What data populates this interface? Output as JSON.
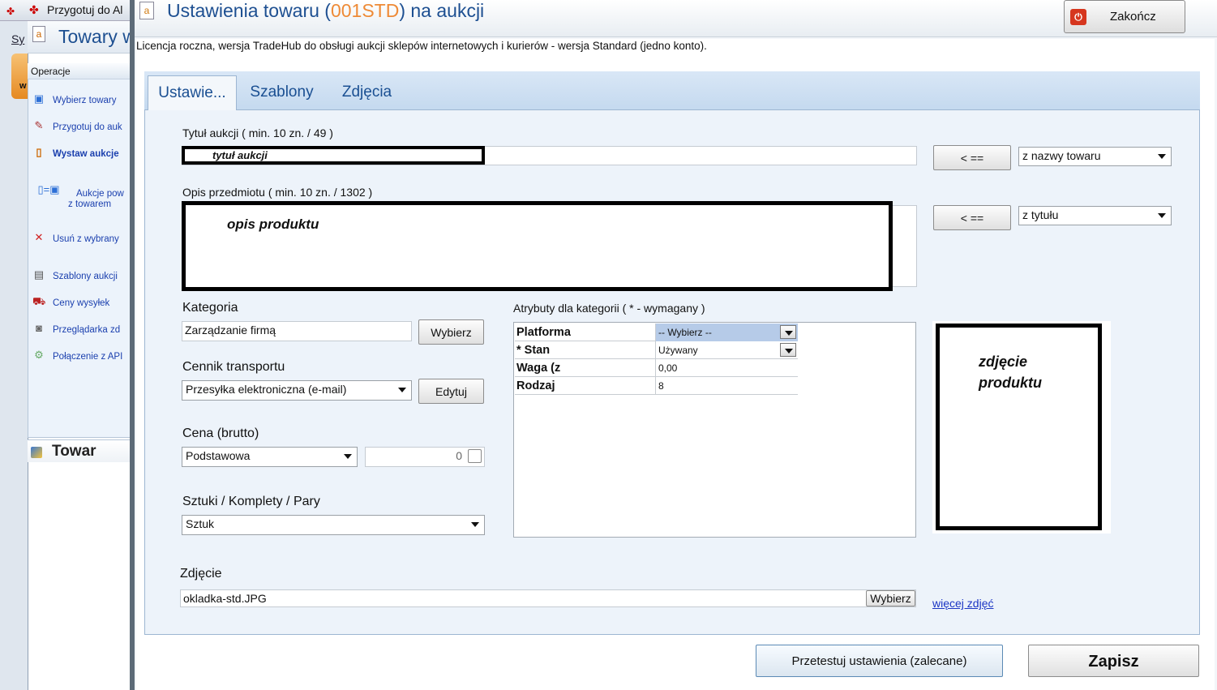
{
  "background": {
    "win1_title": "Przygotuj do Al",
    "menu_sy": "Sy",
    "orange_letter": "w",
    "win2_title": "Towary w",
    "ops_header": "Operacje",
    "ops": [
      {
        "icon": "cube-icon",
        "label": "Wybierz towary"
      },
      {
        "icon": "pencil-icon",
        "label": "Przygotuj do auk"
      },
      {
        "icon": "page-icon",
        "label": "Wystaw aukcje"
      },
      {
        "icon": "link-icon",
        "label": "Aukcje pow",
        "label2": "z towarem"
      },
      {
        "icon": "delete-icon",
        "label": "Usuń z wybrany"
      },
      {
        "icon": "template-icon",
        "label": "Szablony aukcji"
      },
      {
        "icon": "truck-icon",
        "label": "Ceny wysyłek"
      },
      {
        "icon": "camera-icon",
        "label": "Przeglądarka zd"
      },
      {
        "icon": "api-icon",
        "label": "Połączenie z API"
      }
    ],
    "towar_header": "Towar"
  },
  "dialog": {
    "title_pre": "Ustawienia towaru (",
    "title_code": "001STD",
    "title_post": ") na aukcji",
    "close_label": "Zakończ",
    "license": "Licencja roczna, wersja TradeHub do obsługi aukcji sklepów internetowych i kurierów - wersja Standard (jedno konto).",
    "tabs": [
      "Ustawie...",
      "Szablony",
      "Zdjęcia"
    ],
    "active_tab": 0
  },
  "form": {
    "title_label": "Tytuł aukcji ( min. 10 zn. / 49 )",
    "title_value": "tytuł aukcji",
    "title_copy_btn": "< ==",
    "title_source": "z nazwy towaru",
    "desc_label": "Opis przedmiotu ( min. 10 zn. / 1302 )",
    "desc_value": "opis produktu",
    "desc_copy_btn": "< ==",
    "desc_source": "z tytułu",
    "category_label": "Kategoria",
    "category_value": "Zarządzanie firmą",
    "category_btn": "Wybierz",
    "shipping_label": "Cennik transportu",
    "shipping_value": "Przesyłka elektroniczna (e-mail)",
    "shipping_btn": "Edytuj",
    "price_label": "Cena (brutto)",
    "price_type": "Podstawowa",
    "price_value": "0",
    "units_label": "Sztuki / Komplety / Pary",
    "units_value": "Sztuk",
    "photo_label": "Zdjęcie",
    "photo_value": "okladka-std.JPG",
    "photo_btn": "Wybierz",
    "more_photos": "więcej zdjęć",
    "attributes_label": "Atrybuty dla kategorii  ( * - wymagany )",
    "attributes": [
      {
        "key": "Platforma",
        "value": "-- Wybierz --",
        "dropdown": true
      },
      {
        "key": "* Stan",
        "value": "Używany",
        "dropdown": true
      },
      {
        "key": "Waga (z",
        "value": "0,00",
        "dropdown": false
      },
      {
        "key": "Rodzaj",
        "value": "8",
        "dropdown": false
      }
    ],
    "image_placeholder_line1": "zdjęcie",
    "image_placeholder_line2": "produktu"
  },
  "footer": {
    "test_btn": "Przetestuj ustawienia (zalecane)",
    "save_btn": "Zapisz"
  }
}
